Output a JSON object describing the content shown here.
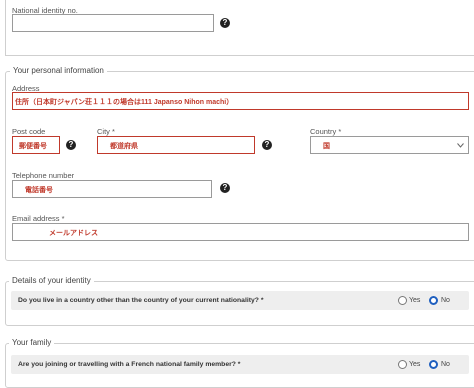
{
  "national_id": {
    "label": "National identity no.",
    "value": ""
  },
  "personal_info": {
    "legend": "Your personal information",
    "address": {
      "label": "Address",
      "value": "住所（日本町ジャパン荘１１１の場合は111 Japanso Nihon machi）"
    },
    "post_code": {
      "label": "Post code",
      "value": "郵便番号"
    },
    "city": {
      "label": "City *",
      "value": "都道府県"
    },
    "country": {
      "label": "Country *",
      "value": "国"
    },
    "telephone": {
      "label": "Telephone number",
      "value": "電話番号"
    },
    "email": {
      "label": "Email address *",
      "value": "メールアドレス"
    }
  },
  "identity": {
    "legend": "Details of your identity",
    "question": "Do you live in a country other than the country of your current nationality? *",
    "yes": "Yes",
    "no": "No",
    "selected": "No"
  },
  "family": {
    "legend": "Your family",
    "question": "Are you joining or travelling with a French national family member? *",
    "yes": "Yes",
    "no": "No",
    "selected": "No"
  },
  "icons": {
    "help": "help-circle-icon",
    "dropdown": "chevron-down-icon"
  },
  "colors": {
    "accent": "#1f5fbf",
    "required_value": "#c0392b",
    "border": "#9a9a9a"
  }
}
